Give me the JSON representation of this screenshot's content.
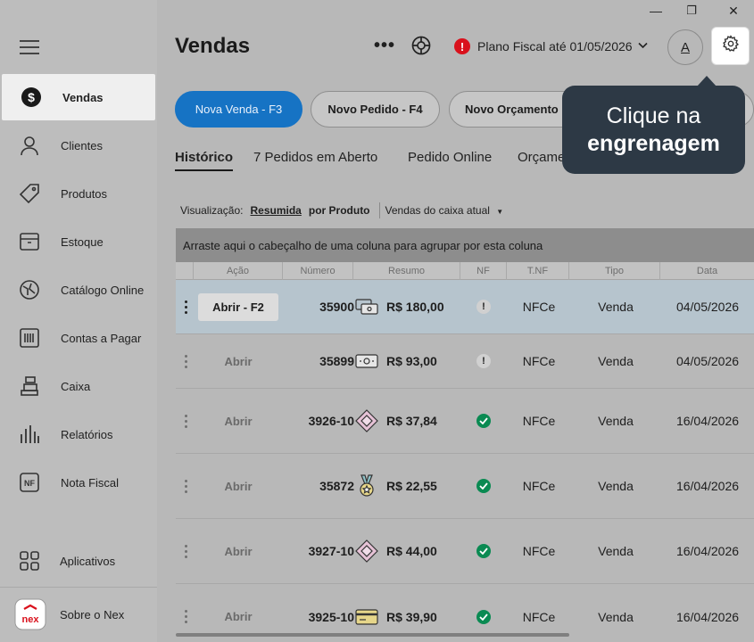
{
  "window": {
    "minimize": "—",
    "restore": "❐",
    "close": "✕"
  },
  "sidebar": {
    "items": [
      {
        "label": "Vendas",
        "icon": "dollar-icon"
      },
      {
        "label": "Clientes",
        "icon": "person-icon"
      },
      {
        "label": "Produtos",
        "icon": "tag-icon"
      },
      {
        "label": "Estoque",
        "icon": "box-icon"
      },
      {
        "label": "Catálogo Online",
        "icon": "catalog-icon"
      },
      {
        "label": "Contas a Pagar",
        "icon": "barcode-icon"
      },
      {
        "label": "Caixa",
        "icon": "cash-register-icon"
      },
      {
        "label": "Relatórios",
        "icon": "bars-icon"
      },
      {
        "label": "Nota Fiscal",
        "icon": "nf-icon"
      }
    ],
    "apps": {
      "label": "Aplicativos",
      "icon": "grid-icon"
    },
    "about": {
      "label": "Sobre o Nex",
      "logo": "nex"
    }
  },
  "header": {
    "title": "Vendas",
    "more": "•••",
    "plan_text": "Plano Fiscal até 01/05/2026",
    "plan_alert": "!",
    "avatar_letter": "A"
  },
  "actions": {
    "nova_venda": "Nova Venda - F3",
    "novo_pedido": "Novo Pedido - F4",
    "novo_orcamento": "Novo Orçamento"
  },
  "tabs": [
    "Histórico",
    "7 Pedidos em Aberto",
    "Pedido Online",
    "Orçame"
  ],
  "view": {
    "label": "Visualização:",
    "resumida": "Resumida",
    "por_produto": "por Produto",
    "caixa": "Vendas do caixa atual"
  },
  "group_band": "Arraste aqui o cabeçalho de uma coluna para agrupar por esta coluna",
  "table": {
    "headers": [
      "Ação",
      "Número",
      "Resumo",
      "NF",
      "T.NF",
      "Tipo",
      "Data"
    ],
    "rows": [
      {
        "action": "Abrir - F2",
        "numero": "35900",
        "payment": "card-cash-icon",
        "valor": "R$ 180,00",
        "nf": "warn",
        "nf_text": "!",
        "tnf": "NFCe",
        "tipo": "Venda",
        "data": "04/05/2026",
        "selected": true
      },
      {
        "action": "Abrir",
        "numero": "35899",
        "payment": "cash-icon",
        "valor": "R$ 93,00",
        "nf": "warn",
        "nf_text": "!",
        "tnf": "NFCe",
        "tipo": "Venda",
        "data": "04/05/2026"
      },
      {
        "action": "Abrir",
        "numero": "3926-10",
        "payment": "pix-icon",
        "valor": "R$ 37,84",
        "nf": "ok",
        "nf_text": "",
        "tnf": "NFCe",
        "tipo": "Venda",
        "data": "16/04/2026"
      },
      {
        "action": "Abrir",
        "numero": "35872",
        "payment": "medal-icon",
        "valor": "R$ 22,55",
        "nf": "ok",
        "nf_text": "",
        "tnf": "NFCe",
        "tipo": "Venda",
        "data": "16/04/2026"
      },
      {
        "action": "Abrir",
        "numero": "3927-10",
        "payment": "pix-icon",
        "valor": "R$ 44,00",
        "nf": "ok",
        "nf_text": "",
        "tnf": "NFCe",
        "tipo": "Venda",
        "data": "16/04/2026"
      },
      {
        "action": "Abrir",
        "numero": "3925-10",
        "payment": "credit-card-icon",
        "valor": "R$ 39,90",
        "nf": "ok",
        "nf_text": "",
        "tnf": "NFCe",
        "tipo": "Venda",
        "data": "16/04/2026"
      }
    ]
  },
  "tooltip": {
    "line1": "Clique na",
    "line2": "engrenagem"
  },
  "colors": {
    "primary": "#1673c4",
    "alert": "#d9111c",
    "ok": "#0a8a52",
    "tooltip": "#2d3945"
  }
}
